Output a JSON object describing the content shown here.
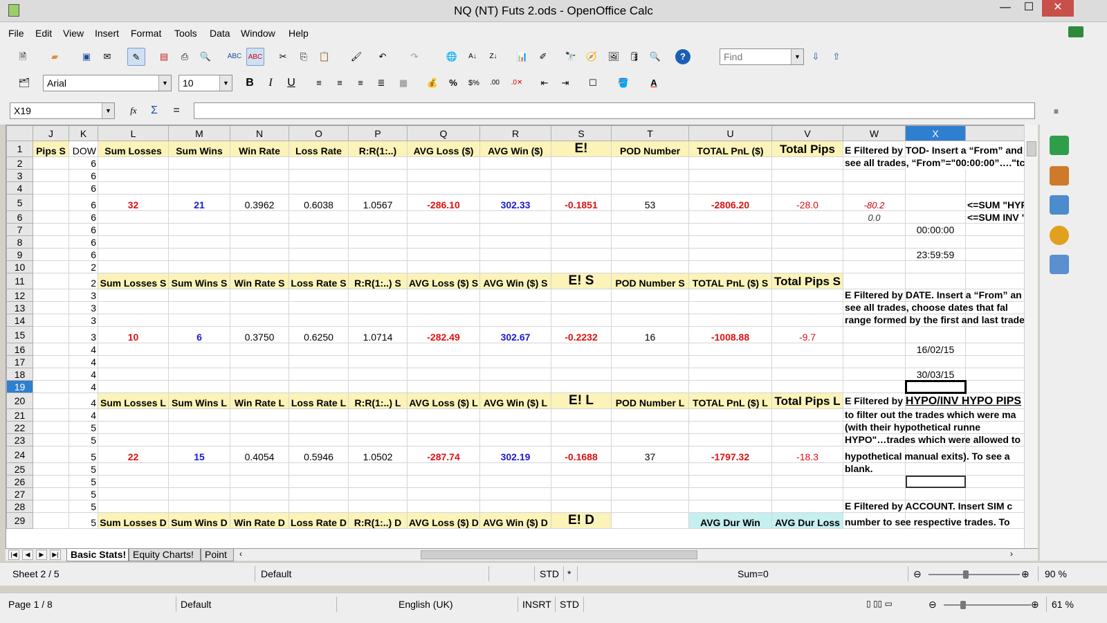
{
  "window": {
    "title": "NQ (NT) Futs 2.ods - OpenOffice Calc",
    "minimize": "—",
    "maximize": "☐",
    "close": "✕"
  },
  "menu": [
    "File",
    "Edit",
    "View",
    "Insert",
    "Format",
    "Tools",
    "Data",
    "Window",
    "Help"
  ],
  "toolbar": {
    "find_placeholder": "Find",
    "font_name": "Arial",
    "font_size": "10"
  },
  "formula": {
    "cell_ref": "X19",
    "content": ""
  },
  "columns": [
    "J",
    "K",
    "L",
    "M",
    "N",
    "O",
    "P",
    "Q",
    "R",
    "S",
    "T",
    "U",
    "V",
    "W",
    "X"
  ],
  "selected_column": "X",
  "selected_row": "19",
  "headers_main": [
    "Pips S",
    "DOW",
    "Sum Losses",
    "Sum Wins",
    "Win Rate",
    "Loss Rate",
    "R:R(1:..)",
    "AVG Loss ($)",
    "AVG Win ($)",
    "E!",
    "POD Number",
    "TOTAL PnL ($)",
    "Total Pips"
  ],
  "headers_s": [
    "",
    "2",
    "Sum Losses S",
    "Sum Wins S",
    "Win Rate S",
    "Loss Rate S",
    "R:R(1:..) S",
    "AVG Loss ($) S",
    "AVG Win ($) S",
    "E! S",
    "POD Number S",
    "TOTAL PnL ($) S",
    "Total Pips S"
  ],
  "headers_l": [
    "",
    "4",
    "Sum Losses L",
    "Sum Wins L",
    "Win Rate L",
    "Loss Rate L",
    "R:R(1:..) L",
    "AVG Loss ($) L",
    "AVG Win ($) L",
    "E! L",
    "POD Number L",
    "TOTAL PnL ($) L",
    "Total Pips L"
  ],
  "headers_d": [
    "",
    "5",
    "Sum Losses D",
    "Sum Wins D",
    "Win Rate D",
    "Loss Rate D",
    "R:R(1:..) D",
    "AVG Loss ($) D",
    "AVG Win ($) D",
    "E! D",
    "",
    "AVG Dur Win",
    "AVG Dur Loss"
  ],
  "stats_all": [
    "32",
    "21",
    "0.3962",
    "0.6038",
    "1.0567",
    "-286.10",
    "302.33",
    "-0.1851",
    "53",
    "-2806.20",
    "-28.0"
  ],
  "stats_s": [
    "10",
    "6",
    "0.3750",
    "0.6250",
    "1.0714",
    "-282.49",
    "302.67",
    "-0.2232",
    "16",
    "-1008.88",
    "-9.7"
  ],
  "stats_l": [
    "22",
    "15",
    "0.4054",
    "0.5946",
    "1.0502",
    "-287.74",
    "302.19",
    "-0.1688",
    "37",
    "-1797.32",
    "-18.3"
  ],
  "dow": {
    "2": "6",
    "3": "6",
    "4": "6",
    "5": "6",
    "6": "6",
    "7": "6",
    "8": "6",
    "9": "6",
    "10": "2",
    "12": "3",
    "13": "3",
    "14": "3",
    "15": "3",
    "16": "4",
    "17": "4",
    "18": "4",
    "19": "4",
    "21": "4",
    "22": "5",
    "23": "5",
    "24": "5",
    "25": "5",
    "26": "5",
    "27": "5",
    "28": "5"
  },
  "side": {
    "w5": "-80.2",
    "w6": "0.0",
    "y5": "<=SUM \"HYPO",
    "y6": "<=SUM INV \"H",
    "x7": "00:00:00",
    "x9": "23:59:59",
    "x16": "16/02/15",
    "x18": "30/03/15",
    "note1a": "E Filtered by TOD- Insert a “From” and",
    "note1b": "see all trades, “From”=\"00:00:00”….\"tc",
    "note2a": "E Filtered by DATE. Insert a “From” an",
    "note2b": "see all trades, choose dates that fal",
    "note2c": "range formed by the first and last trade",
    "note3a_pre": "E Filtered by ",
    "note3a_u": "HYPO/INV HYPO PIPS",
    "note3b": "to filter out the trades which were ma",
    "note3c": "(with     their     hypothetical     runne",
    "note3d": "HYPO\"…trades which were allowed to",
    "note3e": "hypothetical manual exits). To see a",
    "note3f": "blank.",
    "note4a": "E Filtered by ACCOUNT. Insert SIM c",
    "note4b": "number to see respective trades. To"
  },
  "tabs": [
    "Basic Stats!",
    "Equity Charts!",
    "Point"
  ],
  "status1": {
    "sheet": "Sheet 2 / 5",
    "style": "Default",
    "mode": "STD",
    "mod": "*",
    "sum": "Sum=0",
    "zoom": "90 %"
  },
  "status2": {
    "page": "Page 1 / 8",
    "style": "Default",
    "lang": "English (UK)",
    "ins": "INSRT",
    "mode": "STD",
    "zoom": "61 %"
  }
}
